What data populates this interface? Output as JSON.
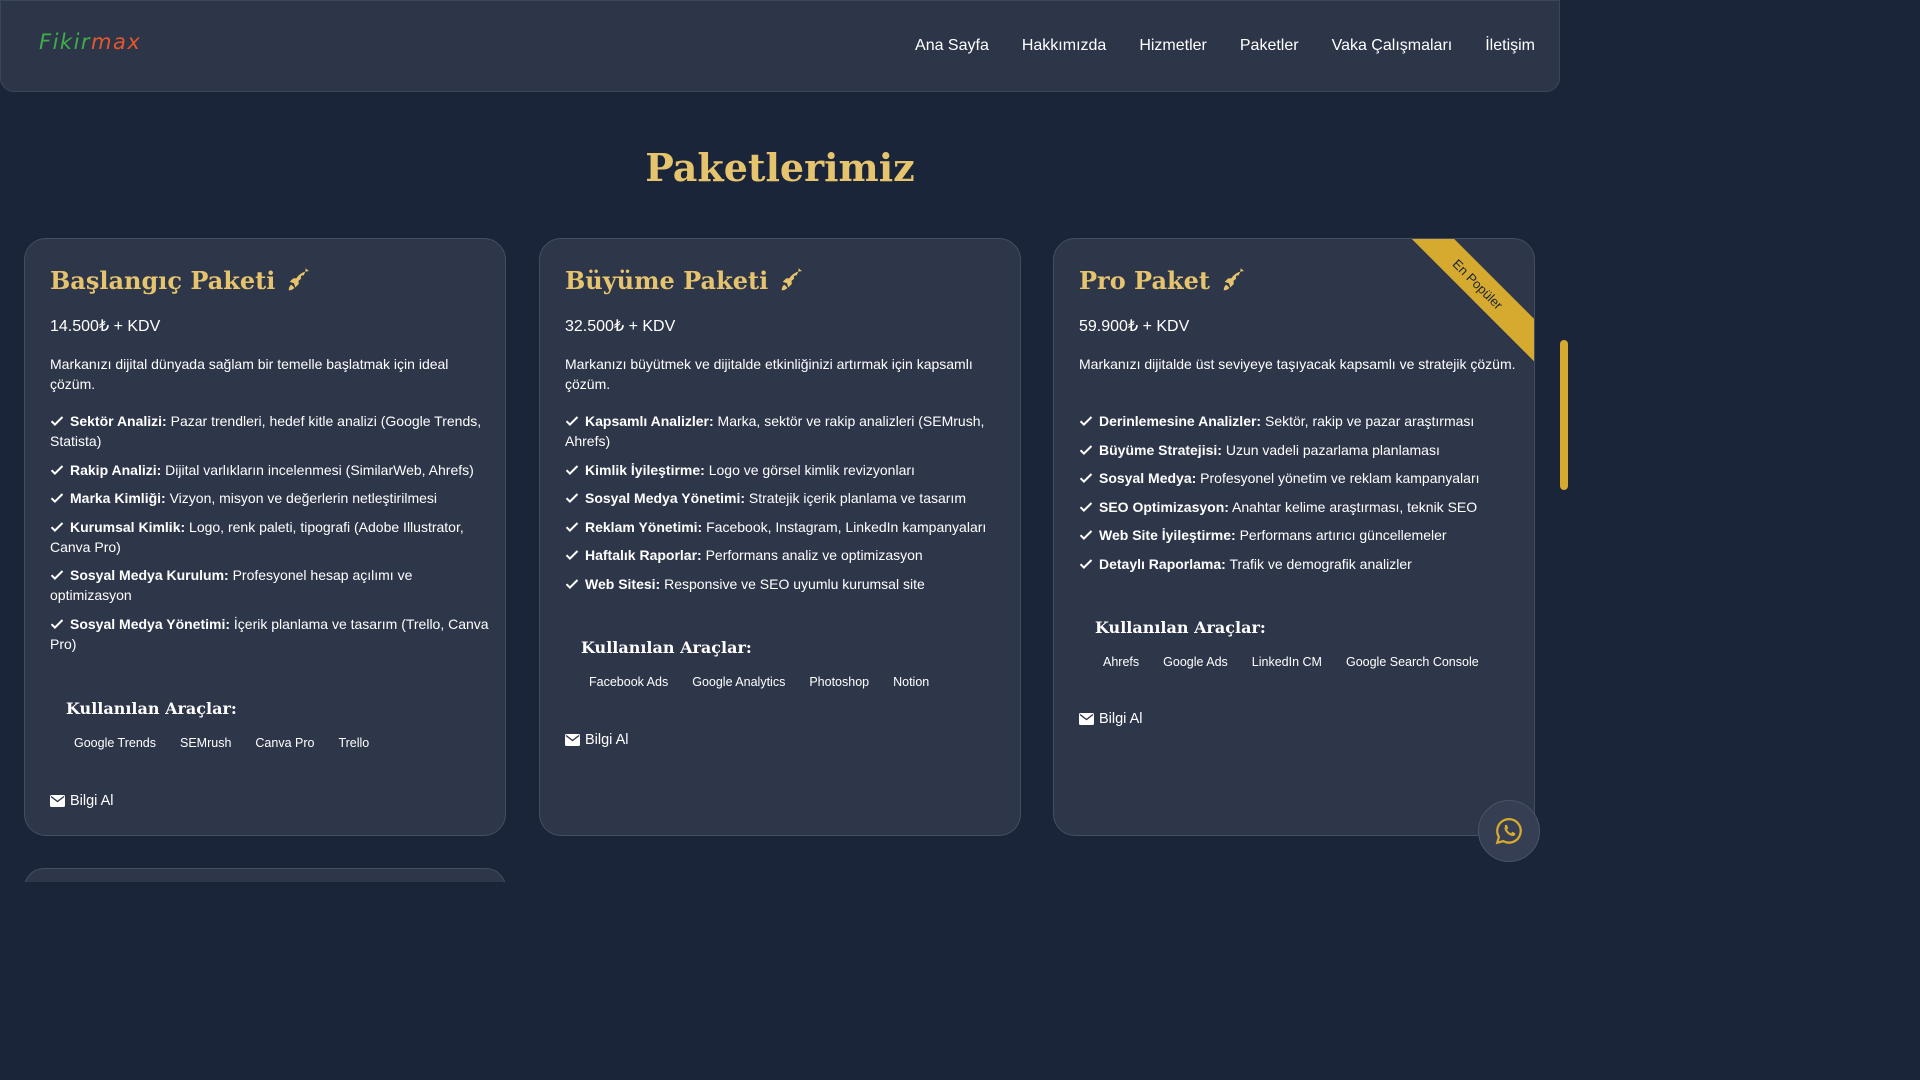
{
  "header": {
    "logo_part1": "Fikir",
    "logo_part2": "max",
    "nav": [
      "Ana Sayfa",
      "Hakkımızda",
      "Hizmetler",
      "Paketler",
      "Vaka Çalışmaları",
      "İletişim"
    ]
  },
  "section_title": "Paketlerimiz",
  "tools_label": "Kullanılan Araçlar:",
  "info_label": "Bilgi Al",
  "packages": [
    {
      "title": "Başlangıç Paketi",
      "price": "14.500₺ + KDV",
      "description": "Markanızı dijital dünyada sağlam bir temelle başlatmak için ideal çözüm.",
      "features": [
        {
          "name": "Sektör Analizi:",
          "text": "Pazar trendleri, hedef kitle analizi (Google Trends, Statista)"
        },
        {
          "name": "Rakip Analizi:",
          "text": "Dijital varlıkların incelenmesi (SimilarWeb, Ahrefs)"
        },
        {
          "name": "Marka Kimliği:",
          "text": "Vizyon, misyon ve değerlerin netleştirilmesi"
        },
        {
          "name": "Kurumsal Kimlik:",
          "text": "Logo, renk paleti, tipografi (Adobe Illustrator, Canva Pro)"
        },
        {
          "name": "Sosyal Medya Kurulum:",
          "text": "Profesyonel hesap açılımı ve optimizasyon"
        },
        {
          "name": "Sosyal Medya Yönetimi:",
          "text": "İçerik planlama ve tasarım (Trello, Canva Pro)"
        }
      ],
      "tools": [
        "Google Trends",
        "SEMrush",
        "Canva Pro",
        "Trello"
      ]
    },
    {
      "title": "Büyüme Paketi",
      "price": "32.500₺ + KDV",
      "description": "Markanızı büyütmek ve dijitalde etkinliğinizi artırmak için kapsamlı çözüm.",
      "features": [
        {
          "name": "Kapsamlı Analizler:",
          "text": "Marka, sektör ve rakip analizleri (SEMrush, Ahrefs)"
        },
        {
          "name": "Kimlik İyileştirme:",
          "text": "Logo ve görsel kimlik revizyonları"
        },
        {
          "name": "Sosyal Medya Yönetimi:",
          "text": "Stratejik içerik planlama ve tasarım"
        },
        {
          "name": "Reklam Yönetimi:",
          "text": "Facebook, Instagram, LinkedIn kampanyaları"
        },
        {
          "name": "Haftalık Raporlar:",
          "text": "Performans analiz ve optimizasyon"
        },
        {
          "name": "Web Sitesi:",
          "text": "Responsive ve SEO uyumlu kurumsal site"
        }
      ],
      "tools": [
        "Facebook Ads",
        "Google Analytics",
        "Photoshop",
        "Notion"
      ]
    },
    {
      "title": "Pro Paket",
      "price": "59.900₺ + KDV",
      "badge": "En Popüler",
      "description": "Markanızı dijitalde üst seviyeye taşıyacak kapsamlı ve stratejik çözüm.",
      "features": [
        {
          "name": "Derinlemesine Analizler:",
          "text": "Sektör, rakip ve pazar araştırması"
        },
        {
          "name": "Büyüme Stratejisi:",
          "text": "Uzun vadeli pazarlama planlaması"
        },
        {
          "name": "Sosyal Medya:",
          "text": "Profesyonel yönetim ve reklam kampanyaları"
        },
        {
          "name": "SEO Optimizasyon:",
          "text": "Anahtar kelime araştırması, teknik SEO"
        },
        {
          "name": "Web Site İyileştirme:",
          "text": "Performans artırıcı güncellemeler"
        },
        {
          "name": "Detaylı Raporlama:",
          "text": "Trafik ve demografik analizler"
        }
      ],
      "tools": [
        "Ahrefs",
        "Google Ads",
        "LinkedIn CM",
        "Google Search Console"
      ]
    }
  ],
  "colors": {
    "background": "#1b2539",
    "card": "#2e3649",
    "gold": "#e6c46e",
    "ribbon": "#d6a92f",
    "logo_green": "#3fae49",
    "logo_orange": "#e4572e"
  },
  "icons": {
    "rocket": "rocket-icon",
    "check": "check-icon",
    "envelope": "envelope-icon",
    "whatsapp": "whatsapp-icon"
  }
}
